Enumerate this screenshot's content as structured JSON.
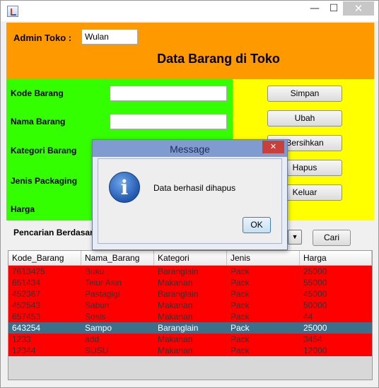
{
  "titlebar": {
    "minimize": "—",
    "maximize": "☐",
    "close": "✕"
  },
  "header": {
    "admin_label": "Admin Toko :",
    "admin_value": "Wulan",
    "title": "Data Barang di Toko"
  },
  "form": {
    "kode_label": "Kode Barang",
    "nama_label": "Nama Barang",
    "kategori_label": "Kategori Barang",
    "jenis_label": "Jenis Packaging",
    "harga_label": "Harga"
  },
  "buttons": {
    "simpan": "Simpan",
    "ubah": "Ubah",
    "bersihkan": "Bersihkan",
    "hapus": "Hapus",
    "keluar": "Keluar",
    "cari": "Cari"
  },
  "search": {
    "label": "Pencarian Berdasarkan",
    "dropdown_icon": "▼"
  },
  "table": {
    "headers": [
      "Kode_Barang",
      "Nama_Barang",
      "Kategori",
      "Jenis",
      "Harga"
    ],
    "rows": [
      [
        "7613425",
        "Buku",
        "Baranglain",
        "Pack",
        "25000"
      ],
      [
        "651434",
        "Telur Asin",
        "Makanan",
        "Pack",
        "55000"
      ],
      [
        "452367",
        "Pastagigi",
        "Baranglain",
        "Pack",
        "45000"
      ],
      [
        "452543",
        "Sabun",
        "Makanan",
        "Pack",
        "50000"
      ],
      [
        "657453",
        "Sosis",
        "Makanan",
        "Pack",
        "44"
      ],
      [
        "643254",
        "Sampo",
        "Baranglain",
        "Pack",
        "25000"
      ],
      [
        "1233",
        "add",
        "Makanan",
        "Pack",
        "3454"
      ],
      [
        "12344",
        "SUSU",
        "Makanan",
        "Pack",
        "12000"
      ]
    ],
    "selected_row": 5
  },
  "dialog": {
    "title": "Message",
    "close": "✕",
    "icon_glyph": "i",
    "message": "Data berhasil dihapus",
    "ok": "OK"
  },
  "colors": {
    "header_bg": "#ff9900",
    "form_bg": "#33ff00",
    "buttons_bg": "#ffff00",
    "row_bg": "#ff0000",
    "row_selected_bg": "#3d6e8a"
  }
}
